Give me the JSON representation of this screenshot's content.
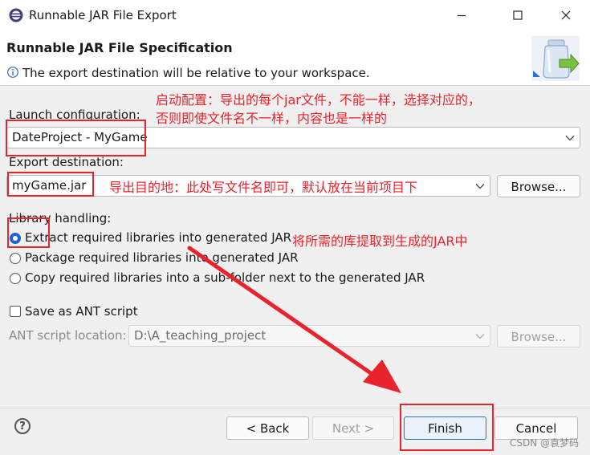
{
  "window": {
    "title": "Runnable JAR File Export"
  },
  "header": {
    "title": "Runnable JAR File Specification",
    "info": "The export destination will be relative to your workspace."
  },
  "launch": {
    "label": "Launch configuration:",
    "value": "DateProject - MyGame"
  },
  "export": {
    "label": "Export destination:",
    "value": "myGame.jar",
    "browse": "Browse..."
  },
  "library": {
    "label": "Library handling:",
    "options": [
      "Extract required libraries into generated JAR",
      "Package required libraries into generated JAR",
      "Copy required libraries into a sub-folder next to the generated JAR"
    ],
    "selected_index": 0
  },
  "ant": {
    "checkbox_label": "Save as ANT script",
    "location_label": "ANT script location:",
    "location_value": "D:\\A_teaching_project",
    "browse": "Browse..."
  },
  "footer": {
    "back": "< Back",
    "next": "Next >",
    "finish": "Finish",
    "cancel": "Cancel"
  },
  "annotations": {
    "launch_note_line1": "启动配置：导出的每个jar文件，不能一样，选择对应的，",
    "launch_note_line2": "否则即使文件名不一样，内容也是一样的",
    "export_note": "导出目的地：此处写文件名即可，默认放在当前项目下",
    "library_note": "将所需的库提取到生成的JAR中",
    "color": "#e8232b"
  },
  "watermark": "CSDN @袁梦码"
}
